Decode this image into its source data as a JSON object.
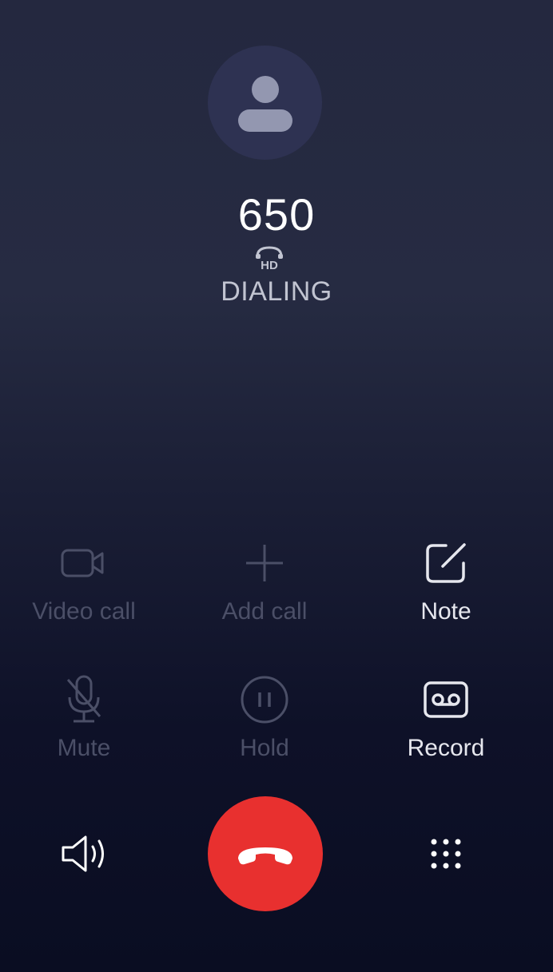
{
  "contact": {
    "number": "650",
    "hd_label": "HD",
    "status": "DIALING"
  },
  "controls": {
    "video_call": {
      "label": "Video call",
      "enabled": false
    },
    "add_call": {
      "label": "Add call",
      "enabled": false
    },
    "note": {
      "label": "Note",
      "enabled": true
    },
    "mute": {
      "label": "Mute",
      "enabled": false
    },
    "hold": {
      "label": "Hold",
      "enabled": false
    },
    "record": {
      "label": "Record",
      "enabled": true
    }
  },
  "bottom_bar": {
    "speaker_icon": "speaker-icon",
    "end_call_icon": "end-call-icon",
    "keypad_icon": "keypad-icon"
  },
  "colors": {
    "end_call": "#e8302f",
    "disabled": "#4b4f67",
    "enabled": "#e6e7ee"
  }
}
